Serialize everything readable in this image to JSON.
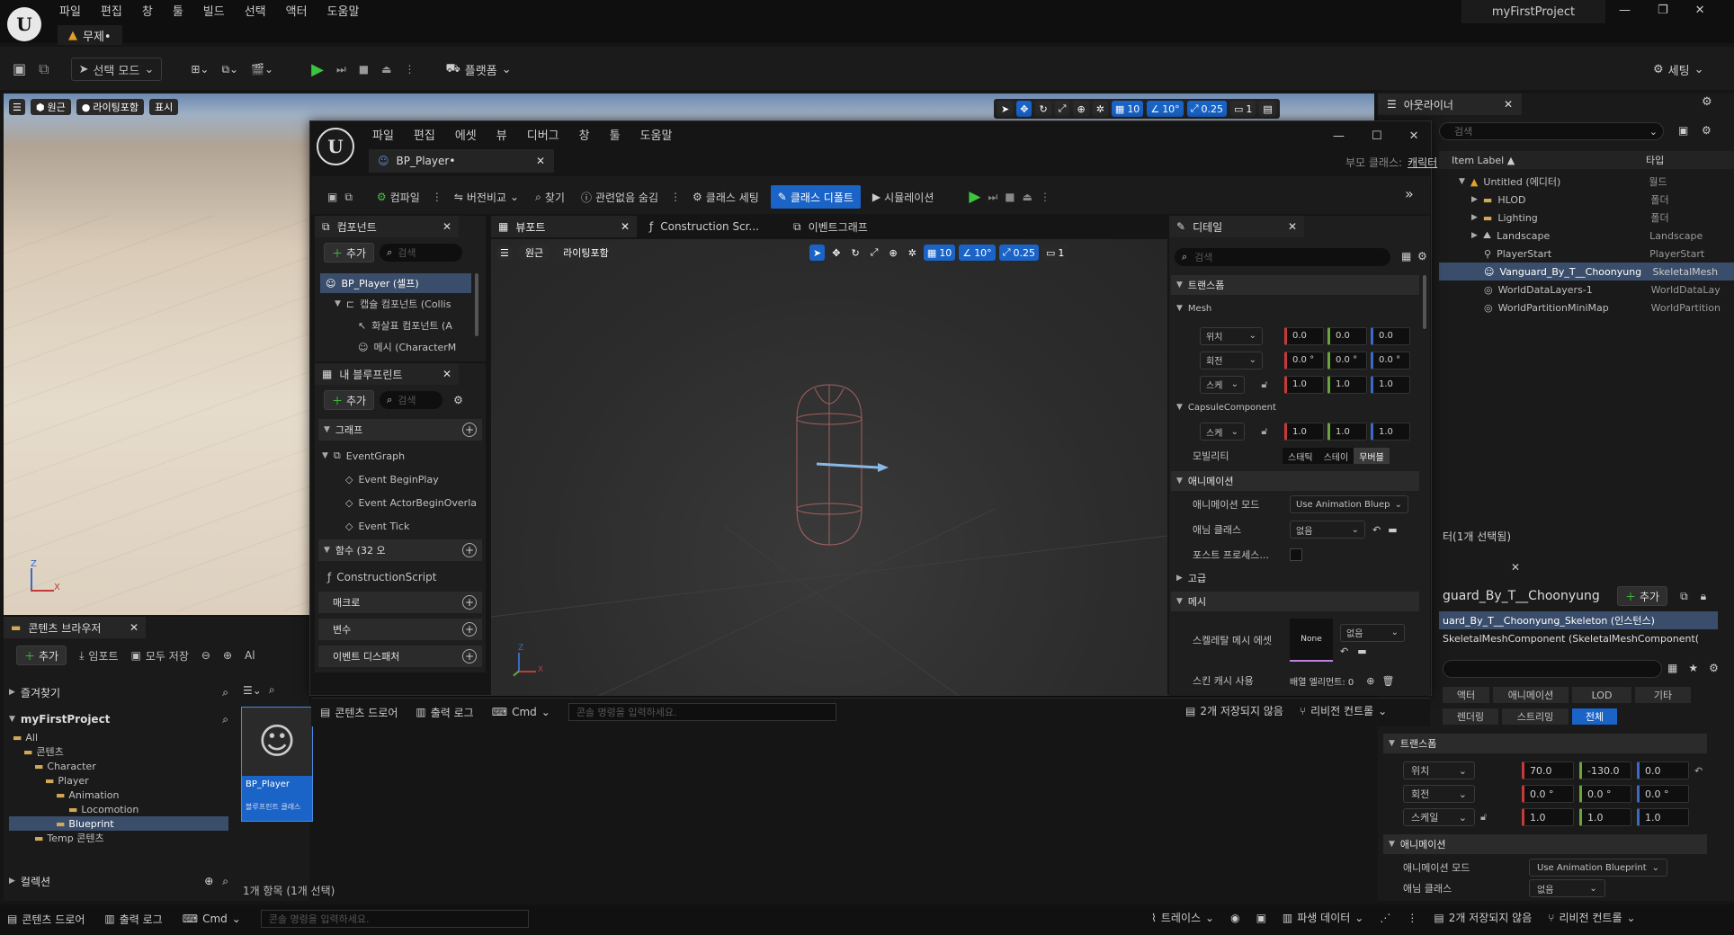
{
  "main_window": {
    "menu": [
      "파일",
      "편집",
      "창",
      "툴",
      "빌드",
      "선택",
      "액터",
      "도움말"
    ],
    "doc_tab": "무제•",
    "project_name": "myFirstProject",
    "toolbar": {
      "select_mode": "선택 모드",
      "platforms": "플랫폼",
      "settings": "세팅"
    },
    "viewport": {
      "perspective": "원근",
      "lit": "라이팅포함",
      "show": "표시",
      "grid": "10",
      "angle": "10°",
      "scale": "0.25",
      "cam": "1"
    }
  },
  "outliner": {
    "title": "아웃라이너",
    "search_placeholder": "검색",
    "col_label": "Item Label ▲",
    "col_type": "타입",
    "rows": [
      {
        "label": "Untitled (에디터)",
        "type": "월드"
      },
      {
        "label": "HLOD",
        "type": "폴더"
      },
      {
        "label": "Lighting",
        "type": "폴더"
      },
      {
        "label": "Landscape",
        "type": "Landscape"
      },
      {
        "label": "PlayerStart",
        "type": "PlayerStart"
      },
      {
        "label": "Vanguard_By_T__Choonyung",
        "type": "SkeletalMesh"
      },
      {
        "label": "WorldDataLayers-1",
        "type": "WorldDataLay"
      },
      {
        "label": "WorldPartitionMiniMap",
        "type": "WorldPartition"
      }
    ],
    "status": "터(1개 선택됨)"
  },
  "details_main": {
    "actor_name": "guard_By_T__Choonyung",
    "add": "추가",
    "component_1": "uard_By_T__Choonyung_Skeleton (인스턴스)",
    "component_2": "SkeletalMeshComponent (SkeletalMeshComponent(",
    "filters_1": [
      "액터",
      "애니메이션",
      "LOD",
      "기타"
    ],
    "filters_2": [
      "렌더링",
      "스트리밍",
      "전체"
    ],
    "transform": "트랜스폼",
    "location": "위치",
    "rotation": "회전",
    "scale": "스케일",
    "loc_vals": [
      "70.0",
      "-130.0",
      "0.0"
    ],
    "rot_vals": [
      "0.0 °",
      "0.0 °",
      "0.0 °"
    ],
    "scale_vals": [
      "1.0",
      "1.0",
      "1.0"
    ],
    "animation": "애니메이션",
    "anim_mode": "애니메이션 모드",
    "anim_mode_val": "Use Animation Blueprint",
    "anim_class": "애님 클래스",
    "anim_class_val": "없음"
  },
  "content_browser": {
    "tab": "콘텐츠 브라우저",
    "add": "추가",
    "import": "임포트",
    "save_all": "모두 저장",
    "path": "Al",
    "favorites": "즐겨찾기",
    "project": "myFirstProject",
    "tree": [
      "All",
      "콘텐츠",
      "Character",
      "Player",
      "Animation",
      "Locomotion",
      "Blueprint",
      "Temp 콘텐츠"
    ],
    "collections": "컬렉션",
    "asset_name": "BP_Player",
    "asset_type": "블루프린트 클래스",
    "status": "1개 항목 (1개 선택)"
  },
  "main_status": {
    "drawer": "콘텐츠 드로어",
    "output": "출력 로그",
    "cmd": "Cmd",
    "console_ph": "콘솔 명령을 입력하세요.",
    "trace": "트레이스",
    "derived": "파생 데이터",
    "unsaved": "2개 저장되지 않음",
    "revision": "리비전 컨트롤"
  },
  "bp_window": {
    "menu": [
      "파일",
      "편집",
      "에셋",
      "뷰",
      "디버그",
      "창",
      "툴",
      "도움말"
    ],
    "tab": "BP_Player•",
    "parent_label": "부모 클래스:",
    "parent_value": "캐릭터",
    "toolbar": {
      "compile": "컴파일",
      "diff": "버전비교",
      "find": "찾기",
      "hide_unrelated": "관련없음 숨김",
      "class_settings": "클래스 세팅",
      "class_defaults": "클래스 디폴트",
      "simulate": "시뮬레이션"
    },
    "components": {
      "title": "컴포넌트",
      "add": "추가",
      "search": "검색",
      "items": [
        "BP_Player (셀프)",
        "캡슐 컴포넌트 (Collis",
        "화살표 컴포넌트 (A",
        "메시 (CharacterM"
      ]
    },
    "my_blueprint": {
      "title": "내 블루프린트",
      "add": "추가",
      "search": "검색",
      "graph": "그래프",
      "event_graph": "EventGraph",
      "events": [
        "Event BeginPlay",
        "Event ActorBeginOverla",
        "Event Tick"
      ],
      "functions": "함수 (32 오",
      "construction": "ConstructionScript",
      "macros": "매크로",
      "variables": "변수",
      "dispatchers": "이벤트 디스패처"
    },
    "center_tabs": [
      "뷰포트",
      "Construction Scr...",
      "이벤트그래프"
    ],
    "viewport": {
      "perspective": "원근",
      "lit": "라이팅포함",
      "grid": "10",
      "angle": "10°",
      "scale": "0.25",
      "cam": "1"
    },
    "details": {
      "title": "디테일",
      "search": "검색",
      "transform": "트랜스폼",
      "mesh_sec": "Mesh",
      "location": "위치",
      "rotation": "회전",
      "scale": "스케",
      "loc": [
        "0.0",
        "0.0",
        "0.0"
      ],
      "rot": [
        "0.0 °",
        "0.0 °",
        "0.0 °"
      ],
      "scl": [
        "1.0",
        "1.0",
        "1.0"
      ],
      "capsule": "CapsuleComponent",
      "cap_scale": [
        "1.0",
        "1.0",
        "1.0"
      ],
      "mobility": "모빌리티",
      "mob_opts": [
        "스태틱",
        "스테이",
        "무버블"
      ],
      "animation": "애니메이션",
      "anim_mode": "애니메이션 모드",
      "anim_mode_val": "Use Animation Bluep",
      "anim_class": "애님 클래스",
      "anim_class_val": "없음",
      "post_process": "포스트 프로세스...",
      "advanced": "고급",
      "mesh": "메시",
      "skeletal_mesh": "스켈레탈 메시 에셋",
      "none_thumb": "None",
      "none_val": "없음",
      "skin_cache": "스킨 캐시 사용",
      "array_elems": "배열 엘리먼트: 0"
    },
    "bottom": {
      "drawer": "콘텐츠 드로어",
      "output": "출력 로그",
      "cmd": "Cmd",
      "console_ph": "콘솔 명령을 입력하세요.",
      "unsaved": "2개 저장되지 않음",
      "revision": "리비전 컨트롤"
    }
  }
}
